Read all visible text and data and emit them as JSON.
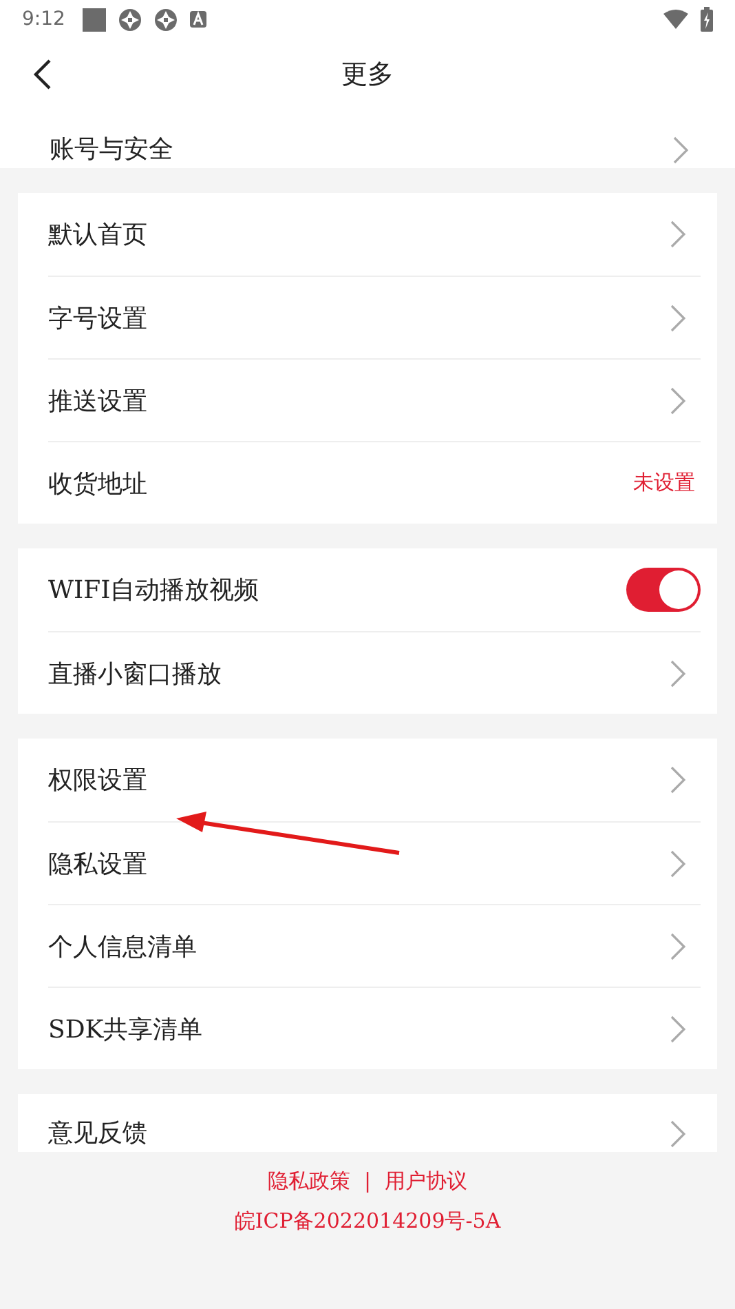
{
  "status_bar": {
    "time": "9:12"
  },
  "header": {
    "title": "更多"
  },
  "sections": [
    {
      "items": [
        {
          "kind": "link",
          "label": "账号与安全"
        }
      ]
    },
    {
      "items": [
        {
          "kind": "link",
          "label": "默认首页"
        },
        {
          "kind": "link",
          "label": "字号设置"
        },
        {
          "kind": "link",
          "label": "推送设置"
        },
        {
          "kind": "value",
          "label": "收货地址",
          "value": "未设置"
        }
      ]
    },
    {
      "items": [
        {
          "kind": "toggle",
          "label": "WIFI自动播放视频",
          "on": true
        },
        {
          "kind": "link",
          "label": "直播小窗口播放"
        }
      ]
    },
    {
      "items": [
        {
          "kind": "link",
          "label": "权限设置"
        },
        {
          "kind": "link",
          "label": "隐私设置"
        },
        {
          "kind": "link",
          "label": "个人信息清单"
        },
        {
          "kind": "link",
          "label": "SDK共享清单"
        }
      ]
    },
    {
      "items": [
        {
          "kind": "link",
          "label": "意见反馈"
        }
      ]
    }
  ],
  "footer": {
    "links": [
      "隐私政策",
      "用户协议"
    ],
    "separator": "|",
    "icp": "皖ICP备2022014209号-5A"
  }
}
